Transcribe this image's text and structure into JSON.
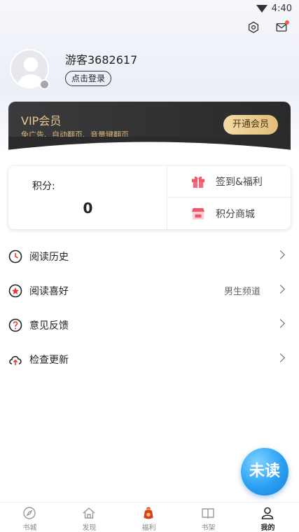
{
  "status_bar": {
    "time": "4:40"
  },
  "profile": {
    "username": "游客3682617",
    "login_label": "点击登录"
  },
  "vip": {
    "title": "VIP会员",
    "subtitle": "免广告、自动翻页、音量键翻页",
    "button_label": "开通会员"
  },
  "points": {
    "label": "积分:",
    "value": "0",
    "checkin_label": "签到&福利",
    "shop_label": "积分商城"
  },
  "menu": {
    "items": [
      {
        "label": "阅读历史",
        "icon": "clock-icon"
      },
      {
        "label": "阅读喜好",
        "icon": "flower-icon",
        "extra": "男生频道"
      },
      {
        "label": "意见反馈",
        "icon": "question-icon"
      },
      {
        "label": "检查更新",
        "icon": "cloud-upload-icon"
      }
    ]
  },
  "fab": {
    "label": "未读"
  },
  "tabs": [
    {
      "label": "书城",
      "icon": "compass-icon"
    },
    {
      "label": "发现",
      "icon": "home-icon"
    },
    {
      "label": "福利",
      "icon": "gift-bag-icon"
    },
    {
      "label": "书架",
      "icon": "book-icon"
    },
    {
      "label": "我的",
      "icon": "user-icon",
      "active": true
    }
  ],
  "colors": {
    "vip_gold": "#e9c88c",
    "accent_red": "#f15b4a",
    "fab_blue": "#2aa0f2"
  }
}
